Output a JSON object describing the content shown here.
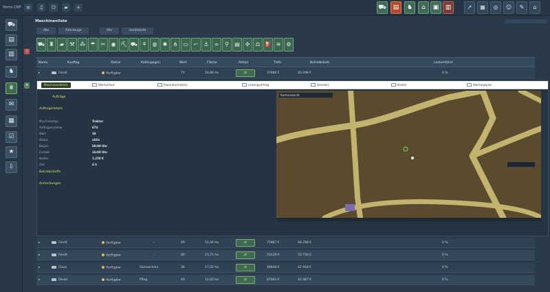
{
  "app": {
    "logo_text": "Metro.CMP"
  },
  "topbar": {
    "left_icons": [
      "menu-icon",
      "bell-icon",
      "power-icon",
      "car-icon",
      "plus-icon"
    ],
    "colored_icons": [
      "tractor-icon",
      "document-icon",
      "animal-icon",
      "barn-icon",
      "vehicle-icon",
      "silo-icon"
    ],
    "right_icons": [
      "chart-icon",
      "map-icon",
      "target-icon",
      "user-icon",
      "note-icon",
      "home-icon"
    ]
  },
  "sidebar": {
    "items": [
      "tractor-icon",
      "book-icon",
      "factory-icon",
      "cow-icon",
      "basket-icon",
      "contract-icon",
      "building-icon",
      "checklist-icon",
      "star-icon",
      "export-icon"
    ]
  },
  "page": {
    "title": "Maschinenliste",
    "subtitle": "",
    "search_placeholder": "",
    "tabs": [
      "Alle",
      "Fahrzeuge",
      "Alle",
      "Geräteliste"
    ]
  },
  "categories": [
    "tractor-icon",
    "harvester-icon",
    "trailer-icon",
    "plough-icon",
    "seeder-icon",
    "sprayer-icon",
    "mower-icon",
    "baler-icon",
    "loader-icon",
    "truck-icon",
    "cultivator-icon",
    "roller-icon",
    "tedder-icon",
    "rake-icon",
    "wagon-icon",
    "forklift-icon",
    "digger-icon",
    "belt-icon",
    "shovel-icon",
    "pallet-icon",
    "spreader-icon",
    "weight-icon",
    "tank-icon",
    "windrower-icon",
    "tool-icon"
  ],
  "table": {
    "headers": [
      "Name",
      "Kauftag",
      "Status",
      "Kaltzugegen",
      "Wert",
      "Fläche",
      "Aktion",
      "Tiefe",
      "Betriebskost.",
      "Leistung",
      "Lastumfahrt"
    ],
    "first_row": {
      "name": "Fendt",
      "status": "Verfügbar",
      "num": "75",
      "area": "16,86 ha",
      "action": "⇄",
      "a": "37880 €",
      "b": "40 298 €",
      "c": "0 %"
    },
    "rows": [
      {
        "name": "Fendt",
        "status": "Verfügbar",
        "tool": "–",
        "num": "89",
        "area": "52,46 ha",
        "action": "⇄",
        "a": "75887 €",
        "b": "48 298 €",
        "c": "0 %"
      },
      {
        "name": "Fendt",
        "status": "Verfügbar",
        "tool": "–",
        "num": "80",
        "area": "23,71 ha",
        "action": "⇄",
        "a": "55428 €",
        "b": "53 756 €",
        "c": "0 %"
      },
      {
        "name": "Claas",
        "status": "Verfügbar",
        "tool": "Sämaschine",
        "num": "36",
        "area": "17,02 ha",
        "action": "⇄",
        "a": "48848 €",
        "b": "42 918 €",
        "c": "0 %"
      },
      {
        "name": "Deutz",
        "status": "Verfügbar",
        "tool": "Pflug",
        "num": "40",
        "area": "12,05 ha",
        "action": "⇄",
        "a": "87461 €",
        "b": "41 087 €",
        "c": "0 %"
      }
    ]
  },
  "detail": {
    "tabs": [
      "Maschinendetails",
      "Wertverlauf",
      "Reparaturhistorie",
      "Leasingvertrag",
      "Standort",
      "Kosten",
      "Wartungsplan"
    ],
    "panel_title": "Aufträge",
    "section1_title": "Auftragsdetails",
    "section1_desc": "",
    "fields": [
      {
        "k": "Maschinentyp",
        "v": "Traktor"
      },
      {
        "k": "Auftragsnummer",
        "v": "674"
      },
      {
        "k": "Wert",
        "v": "38"
      },
      {
        "k": "Status",
        "v": "aktiv"
      },
      {
        "k": "Beginn",
        "v": "08:00 Uhr"
      },
      {
        "k": "Endzeit",
        "v": "16:00 Uhr"
      },
      {
        "k": "Kosten",
        "v": "1.250 €"
      },
      {
        "k": "Zeit",
        "v": "4 h"
      }
    ],
    "section2_title": "Betriebsstoffe",
    "section2_desc": "",
    "section3_title": "Anmerkungen",
    "section3_desc": "",
    "section3_desc2": "",
    "map_header": "Kartenansicht",
    "map_label_1": "",
    "map_label_2": "",
    "map_footer": ""
  },
  "colors": {
    "accent": "#d9e85a",
    "map_bg": "#5a4a2e",
    "road": "#c2b46c",
    "button_green": "#3e6a4d"
  }
}
